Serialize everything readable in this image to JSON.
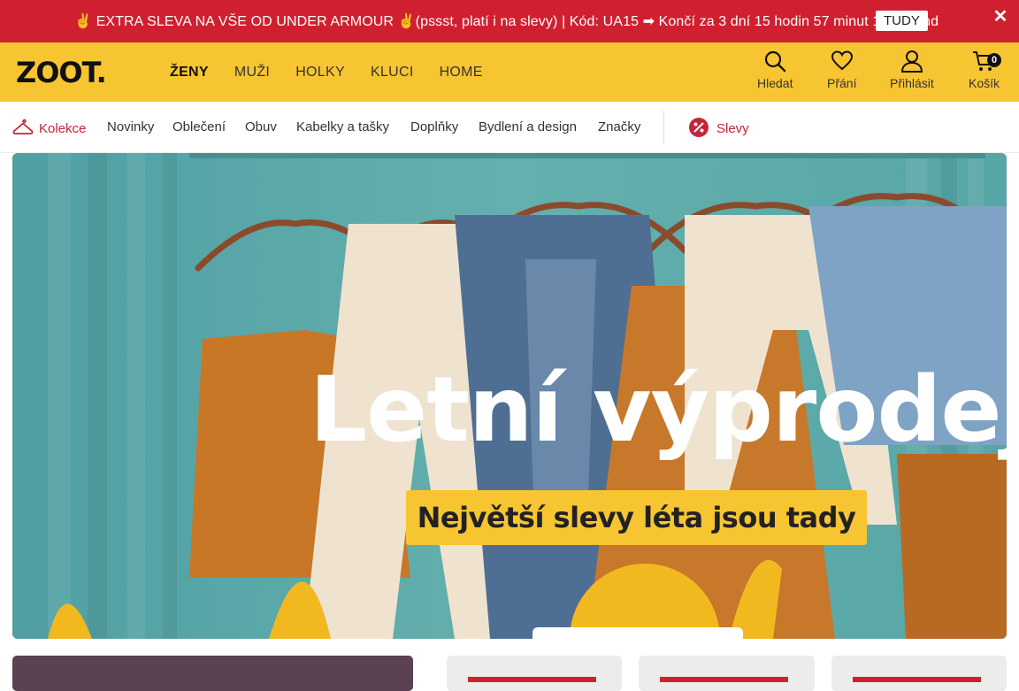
{
  "promo": {
    "text": "✌ EXTRA SLEVA NA VŠE OD UNDER ARMOUR ✌(pssst, platí i na slevy) | Kód: UA15 ➡ Končí za 3 dní 15 hodin 57 minut 18 sekund",
    "button": "TUDY",
    "close_icon": "close-icon",
    "color": "#d0202f"
  },
  "header": {
    "logo": "ZOOT.",
    "color": "#f8c532",
    "nav": [
      "ŽENY",
      "MUŽI",
      "HOLKY",
      "KLUCI",
      "HOME"
    ],
    "active_nav": "ŽENY",
    "tools": {
      "search": "Hledat",
      "wishlist": "Přání",
      "login": "Přihlásit",
      "cart": "Košík",
      "cart_count": "0"
    }
  },
  "categories": {
    "kolekce": "Kolekce",
    "novinky": "Novinky",
    "obleceni": "Oblečení",
    "obuv": "Obuv",
    "kabelky": "Kabelky a tašky",
    "doplnky": "Doplňky",
    "bydleni": "Bydlení a design",
    "znacky": "Značky",
    "slevy": "Slevy",
    "accent": "#c4243a"
  },
  "hero": {
    "title": "Letní výprodej",
    "cta": "Největší slevy léta jsou tady"
  }
}
